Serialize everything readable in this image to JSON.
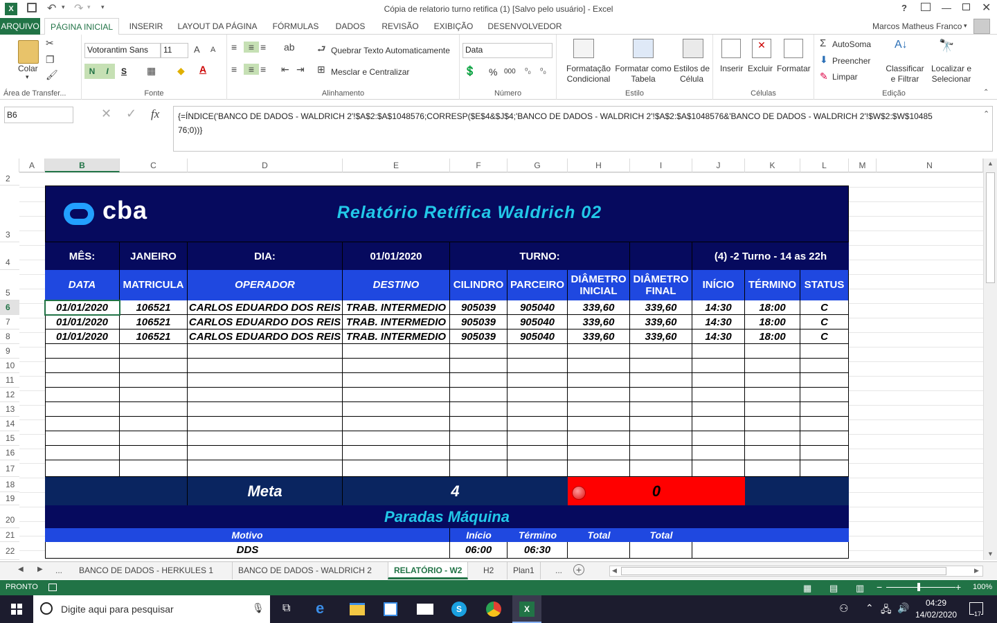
{
  "window": {
    "title": "Cópia de relatorio turno retifica (1) [Salvo pelo usuário] - Excel",
    "help": "?",
    "user": "Marcos Matheus Franco"
  },
  "ribbon_tabs": [
    "ARQUIVO",
    "PÁGINA INICIAL",
    "INSERIR",
    "LAYOUT DA PÁGINA",
    "FÓRMULAS",
    "DADOS",
    "REVISÃO",
    "EXIBIÇÃO",
    "DESENVOLVEDOR"
  ],
  "ribbon": {
    "clipboard": {
      "paste": "Colar",
      "label": "Área de Transfer..."
    },
    "font": {
      "name": "Votorantim Sans",
      "size": "11",
      "bold": "N",
      "italic": "I",
      "underline": "S",
      "label": "Fonte"
    },
    "alignment": {
      "wrap": "Quebrar Texto Automaticamente",
      "merge": "Mesclar e Centralizar",
      "label": "Alinhamento"
    },
    "number": {
      "format": "Data",
      "percent": "%",
      "thousands": "000",
      "label": "Número"
    },
    "styles": {
      "conditional": "Formatação Condicional",
      "table": "Formatar como Tabela",
      "cell_styles": "Estilos de Célula",
      "label": "Estilo"
    },
    "cells": {
      "insert": "Inserir",
      "delete": "Excluir",
      "format": "Formatar",
      "label": "Células"
    },
    "editing": {
      "autosum": "AutoSoma",
      "fill": "Preencher",
      "clear": "Limpar",
      "sort": "Classificar e Filtrar",
      "find": "Localizar e Selecionar",
      "label": "Edição"
    }
  },
  "formula_bar": {
    "name_box": "B6",
    "fx": "fx",
    "formula": "{=ÍNDICE('BANCO DE DADOS - WALDRICH 2'!$A$2:$A$1048576;CORRESP($E$4&$J$4;'BANCO DE DADOS - WALDRICH 2'!$A$2:$A$1048576&'BANCO DE DADOS - WALDRICH 2'!$W$2:$W$1048576;0))}"
  },
  "columns": [
    "A",
    "B",
    "C",
    "D",
    "E",
    "F",
    "G",
    "H",
    "I",
    "J",
    "K",
    "L",
    "M",
    "N"
  ],
  "rows": [
    "2",
    "3",
    "4",
    "5",
    "6",
    "7",
    "8",
    "9",
    "10",
    "11",
    "12",
    "13",
    "14",
    "15",
    "16",
    "17",
    "18",
    "19",
    "20",
    "21",
    "22"
  ],
  "report": {
    "logo": "cba",
    "title": "Relatório Retífica Waldrich 02",
    "mes_label": "MÊS:",
    "mes": "JANEIRO",
    "dia_label": "DIA:",
    "dia": "01/01/2020",
    "turno_label": "TURNO:",
    "turno": "(4) -2 Turno - 14 as 22h",
    "headers": [
      "DATA",
      "MATRICULA",
      "OPERADOR",
      "DESTINO",
      "CILINDRO",
      "PARCEIRO",
      "DIÂMETRO INICIAL",
      "DIÂMETRO FINAL",
      "INÍCIO",
      "TÉRMINO",
      "STATUS"
    ],
    "rows": [
      [
        "01/01/2020",
        "106521",
        "CARLOS EDUARDO DOS REIS",
        "TRAB. INTERMEDIO",
        "905039",
        "905040",
        "339,60",
        "339,60",
        "14:30",
        "18:00",
        "C"
      ],
      [
        "01/01/2020",
        "106521",
        "CARLOS EDUARDO DOS REIS",
        "TRAB. INTERMEDIO",
        "905039",
        "905040",
        "339,60",
        "339,60",
        "14:30",
        "18:00",
        "C"
      ],
      [
        "01/01/2020",
        "106521",
        "CARLOS EDUARDO DOS REIS",
        "TRAB. INTERMEDIO",
        "905039",
        "905040",
        "339,60",
        "339,60",
        "14:30",
        "18:00",
        "C"
      ]
    ],
    "meta_label": "Meta",
    "meta_value": "4",
    "result_value": "0",
    "paradas_title": "Paradas Máquina",
    "paradas_headers": {
      "motivo": "Motivo",
      "inicio": "Início",
      "termino": "Término",
      "total1": "Total",
      "total2": "Total"
    },
    "paradas_rows": [
      {
        "motivo": "DDS",
        "inicio": "06:00",
        "termino": "06:30"
      }
    ]
  },
  "sheet_tabs": [
    "BANCO DE DADOS - HERKULES 1",
    "BANCO DE DADOS - WALDRICH 2",
    "RELATÓRIO - W2",
    "H2",
    "Plan1"
  ],
  "sheet_tabs_more": "...",
  "active_sheet": "RELATÓRIO - W2",
  "status": {
    "mode": "PRONTO",
    "zoom": "100%"
  },
  "taskbar": {
    "search_placeholder": "Digite aqui para pesquisar",
    "time": "04:29",
    "date": "14/02/2020",
    "notif": "17"
  },
  "colors": {
    "excel_green": "#217346",
    "navy": "#060a5e",
    "blue_header": "#1f48e0",
    "title_cyan": "#22c8e8",
    "red": "#ff0000"
  }
}
